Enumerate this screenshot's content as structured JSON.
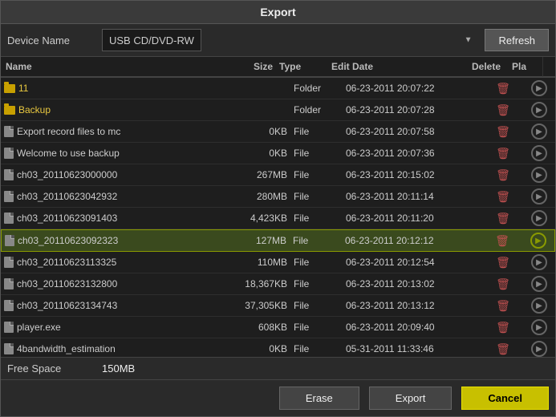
{
  "dialog": {
    "title": "Export"
  },
  "device": {
    "label": "Device Name",
    "value": "USB CD/DVD-RW",
    "refresh_label": "Refresh"
  },
  "table": {
    "columns": [
      "Name",
      "Size",
      "Type",
      "Edit Date",
      "Delete",
      "Pla"
    ],
    "rows": [
      {
        "name": "11",
        "size": "",
        "type": "Folder",
        "date": "06-23-2011 20:07:22",
        "is_folder": true,
        "highlighted": false
      },
      {
        "name": "Backup",
        "size": "",
        "type": "Folder",
        "date": "06-23-2011 20:07:28",
        "is_folder": true,
        "highlighted": false
      },
      {
        "name": "Export record files to mc",
        "size": "0KB",
        "type": "File",
        "date": "06-23-2011 20:07:58",
        "is_folder": false,
        "highlighted": false
      },
      {
        "name": "Welcome to use backup",
        "size": "0KB",
        "type": "File",
        "date": "06-23-2011 20:07:36",
        "is_folder": false,
        "highlighted": false
      },
      {
        "name": "ch03_20110623000000",
        "size": "267MB",
        "type": "File",
        "date": "06-23-2011 20:15:02",
        "is_folder": false,
        "highlighted": false
      },
      {
        "name": "ch03_20110623042932",
        "size": "280MB",
        "type": "File",
        "date": "06-23-2011 20:11:14",
        "is_folder": false,
        "highlighted": false
      },
      {
        "name": "ch03_20110623091403",
        "size": "4,423KB",
        "type": "File",
        "date": "06-23-2011 20:11:20",
        "is_folder": false,
        "highlighted": false
      },
      {
        "name": "ch03_20110623092323",
        "size": "127MB",
        "type": "File",
        "date": "06-23-2011 20:12:12",
        "is_folder": false,
        "highlighted": true
      },
      {
        "name": "ch03_20110623113325",
        "size": "110MB",
        "type": "File",
        "date": "06-23-2011 20:12:54",
        "is_folder": false,
        "highlighted": false
      },
      {
        "name": "ch03_20110623132800",
        "size": "18,367KB",
        "type": "File",
        "date": "06-23-2011 20:13:02",
        "is_folder": false,
        "highlighted": false
      },
      {
        "name": "ch03_20110623134743",
        "size": "37,305KB",
        "type": "File",
        "date": "06-23-2011 20:13:12",
        "is_folder": false,
        "highlighted": false
      },
      {
        "name": "player.exe",
        "size": "608KB",
        "type": "File",
        "date": "06-23-2011 20:09:40",
        "is_folder": false,
        "highlighted": false
      },
      {
        "name": "4bandwidth_estimation",
        "size": "0KB",
        "type": "File",
        "date": "05-31-2011 11:33:46",
        "is_folder": false,
        "highlighted": false
      }
    ]
  },
  "free_space": {
    "label": "Free Space",
    "value": "150MB"
  },
  "buttons": {
    "erase": "Erase",
    "export": "Export",
    "cancel": "Cancel"
  }
}
